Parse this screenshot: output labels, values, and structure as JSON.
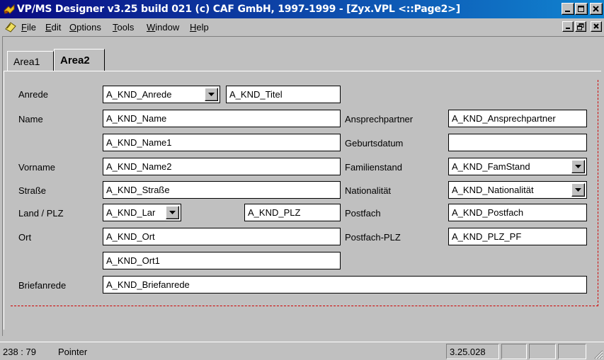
{
  "window": {
    "title": "VP/MS Designer v3.25 build 021 (c) CAF GmbH, 1997-1999 - [Zyx.VPL <::Page2>]",
    "titlebar_color": "#0a0a82"
  },
  "menu": {
    "items": [
      {
        "accel": "F",
        "rest": "ile"
      },
      {
        "accel": "E",
        "rest": "dit"
      },
      {
        "accel": "O",
        "rest": "ptions"
      },
      {
        "accel": "T",
        "rest": "ools"
      },
      {
        "accel": "W",
        "rest": "indow"
      },
      {
        "accel": "H",
        "rest": "elp"
      }
    ]
  },
  "tabs": [
    {
      "label": "Area1",
      "active": false
    },
    {
      "label": "Area2",
      "active": true
    }
  ],
  "form": {
    "labels": {
      "anrede": "Anrede",
      "name": "Name",
      "vorname": "Vorname",
      "strasse": "Straße",
      "land_plz": "Land / PLZ",
      "ort": "Ort",
      "briefanrede": "Briefanrede",
      "ansprechpartner": "Ansprechpartner",
      "geburtsdatum": "Geburtsdatum",
      "familienstand": "Familienstand",
      "nationalitaet": "Nationalität",
      "postfach": "Postfach",
      "postfach_plz": "Postfach-PLZ"
    },
    "values": {
      "anrede": "A_KND_Anrede",
      "titel": "A_KND_Titel",
      "name": "A_KND_Name",
      "name1": "A_KND_Name1",
      "name2": "A_KND_Name2",
      "strasse": "A_KND_Straße",
      "land": "A_KND_Lar",
      "plz": "A_KND_PLZ",
      "ort": "A_KND_Ort",
      "ort1": "A_KND_Ort1",
      "briefanrede": "A_KND_Briefanrede",
      "ansprechpartner": "A_KND_Ansprechpartner",
      "geburtsdatum": "",
      "famstand": "A_KND_FamStand",
      "nationalitaet": "A_KND_Nationalität",
      "postfach": "A_KND_Postfach",
      "plz_pf": "A_KND_PLZ_PF"
    }
  },
  "status": {
    "coords": "238 : 79",
    "mode": "Pointer",
    "version": "3.25.028"
  },
  "icons": [
    "app-icon",
    "minimize-icon",
    "maximize-icon",
    "close-icon",
    "document-icon",
    "restore-icon",
    "dropdown-arrow-icon",
    "size-grip-icon"
  ]
}
